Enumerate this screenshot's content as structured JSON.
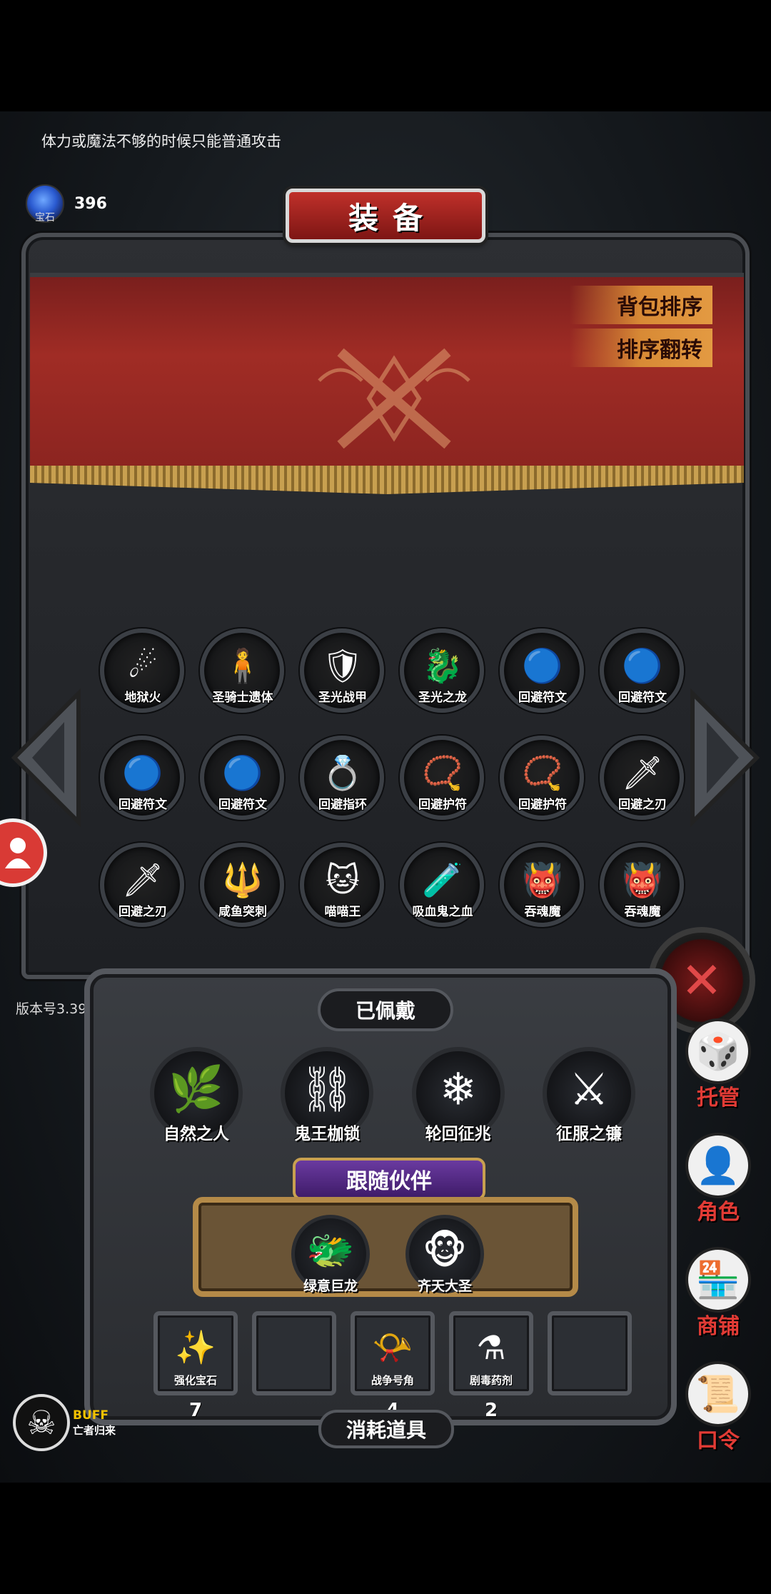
{
  "hint": "体力或魔法不够的时候只能普通攻击",
  "gem": {
    "label": "宝石",
    "count": "396"
  },
  "panel": {
    "title": "装备",
    "sort_bag": "背包排序",
    "sort_reverse": "排序翻转"
  },
  "inventory": [
    {
      "label": "地狱火",
      "icon": "fireball-icon",
      "glyph": "☄"
    },
    {
      "label": "圣骑士遗体",
      "icon": "body-icon",
      "glyph": "🧍"
    },
    {
      "label": "圣光战甲",
      "icon": "armor-icon",
      "glyph": "🛡"
    },
    {
      "label": "圣光之龙",
      "icon": "dragon-icon",
      "glyph": "🐉"
    },
    {
      "label": "回避符文",
      "icon": "rune-icon",
      "glyph": "🔵"
    },
    {
      "label": "回避符文",
      "icon": "rune-icon",
      "glyph": "🔵"
    },
    {
      "label": "回避符文",
      "icon": "rune-icon",
      "glyph": "🔵"
    },
    {
      "label": "回避符文",
      "icon": "rune-icon",
      "glyph": "🔵"
    },
    {
      "label": "回避指环",
      "icon": "ring-icon",
      "glyph": "💍"
    },
    {
      "label": "回避护符",
      "icon": "amulet-icon",
      "glyph": "📿"
    },
    {
      "label": "回避护符",
      "icon": "amulet-icon",
      "glyph": "📿"
    },
    {
      "label": "回避之刃",
      "icon": "blade-icon",
      "glyph": "🗡"
    },
    {
      "label": "回避之刃",
      "icon": "blade-icon",
      "glyph": "🗡"
    },
    {
      "label": "咸鱼突刺",
      "icon": "spear-icon",
      "glyph": "🔱"
    },
    {
      "label": "喵喵王",
      "icon": "cat-king-icon",
      "glyph": "🐱"
    },
    {
      "label": "吸血鬼之血",
      "icon": "potion-icon",
      "glyph": "🧪"
    },
    {
      "label": "吞魂魔",
      "icon": "demon-icon",
      "glyph": "👹"
    },
    {
      "label": "吞魂魔",
      "icon": "demon-icon",
      "glyph": "👹"
    }
  ],
  "version": "版本号3.39",
  "worn": {
    "title": "已佩戴",
    "items": [
      {
        "label": "自然之人",
        "icon": "nature-man-icon",
        "glyph": "🌿"
      },
      {
        "label": "鬼王枷锁",
        "icon": "chain-icon",
        "glyph": "⛓"
      },
      {
        "label": "轮回征兆",
        "icon": "staff-icon",
        "glyph": "❄"
      },
      {
        "label": "征服之镰",
        "icon": "scythe-icon",
        "glyph": "⚔"
      }
    ]
  },
  "partners": {
    "title": "跟随伙伴",
    "items": [
      {
        "label": "绿意巨龙",
        "icon": "green-dragon-icon",
        "glyph": "🐲"
      },
      {
        "label": "齐天大圣",
        "icon": "monkey-king-icon",
        "glyph": "🐵"
      }
    ]
  },
  "consumables": {
    "title": "消耗道具",
    "items": [
      {
        "label": "强化宝石",
        "count": "7",
        "icon": "gem-icon",
        "glyph": "✨"
      },
      {
        "label": "",
        "count": "",
        "icon": "",
        "glyph": ""
      },
      {
        "label": "战争号角",
        "count": "4",
        "icon": "horn-icon",
        "glyph": "📯"
      },
      {
        "label": "剧毒药剂",
        "count": "2",
        "icon": "poison-icon",
        "glyph": "⚗"
      },
      {
        "label": "",
        "count": "",
        "icon": "",
        "glyph": ""
      }
    ]
  },
  "side_menu": [
    {
      "label": "托管",
      "icon": "dice-icon",
      "glyph": "🎲"
    },
    {
      "label": "角色",
      "icon": "hood-icon",
      "glyph": "👤"
    },
    {
      "label": "商铺",
      "icon": "shop-icon",
      "glyph": "🏪"
    },
    {
      "label": "口令",
      "icon": "scroll-icon",
      "glyph": "📜"
    }
  ],
  "buff": {
    "tag": "BUFF",
    "name": "亡者归来"
  }
}
